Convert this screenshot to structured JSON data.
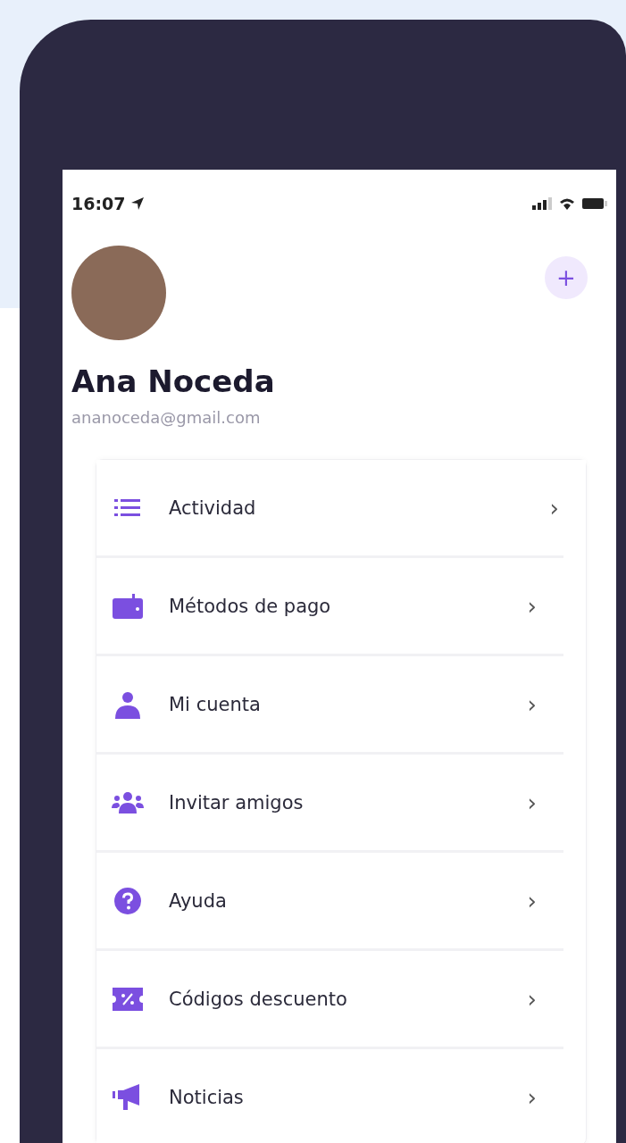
{
  "status_bar": {
    "time": "16:07"
  },
  "profile": {
    "name": "Ana Noceda",
    "email": "ananoceda@gmail.com",
    "add_button": "+"
  },
  "menu": [
    {
      "label": "Actividad",
      "chevron": "›"
    },
    {
      "label": "Métodos de pago",
      "chevron": "›"
    },
    {
      "label": "Mi cuenta",
      "chevron": "›"
    },
    {
      "label": "Invitar amigos",
      "chevron": "›"
    },
    {
      "label": "Ayuda",
      "chevron": "›"
    },
    {
      "label": "Códigos descuento",
      "chevron": "›"
    },
    {
      "label": "Noticias",
      "chevron": "›"
    }
  ]
}
